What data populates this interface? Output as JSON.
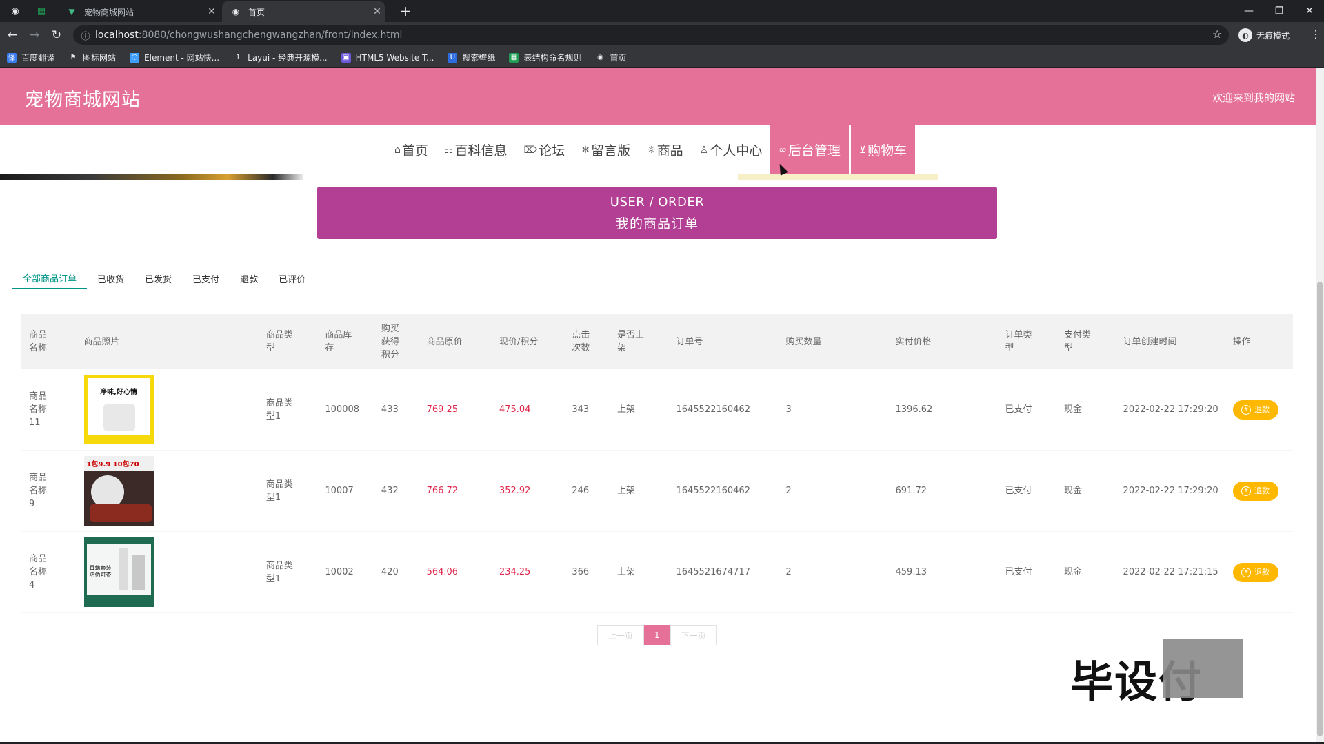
{
  "browser": {
    "tabs": [
      {
        "title": "宠物商城网站",
        "icon": "vue-favicon",
        "active": false
      },
      {
        "title": "首页",
        "icon": "globe-favicon",
        "active": true
      }
    ],
    "address": {
      "host": "localhost",
      "rest": ":8080/chongwushangchengwangzhan/front/index.html"
    },
    "incognito_label": "无痕模式",
    "bookmarks": [
      {
        "label": "百度翻译",
        "icon": "translate-icon",
        "color": "#3a7cf2"
      },
      {
        "label": "图标网站",
        "icon": "flag-icon",
        "color": "#555555"
      },
      {
        "label": "Element - 网站快...",
        "icon": "element-icon",
        "color": "#409eff"
      },
      {
        "label": "Layui - 经典开源模...",
        "icon": "layui-icon",
        "color": "#444444"
      },
      {
        "label": "HTML5 Website T...",
        "icon": "html5-icon",
        "color": "#6b57d8"
      },
      {
        "label": "搜索壁纸",
        "icon": "u-icon",
        "color": "#2d6cdf"
      },
      {
        "label": "表结构命名规则",
        "icon": "sheet-icon",
        "color": "#1f9d55"
      },
      {
        "label": "首页",
        "icon": "globe-icon",
        "color": "#777777"
      }
    ]
  },
  "site": {
    "title": "宠物商城网站",
    "welcome": "欢迎来到我的网站",
    "accent": "#e57198"
  },
  "nav": [
    {
      "label": "首页",
      "icon": "home-icon",
      "glyph": "⌂",
      "active": false
    },
    {
      "label": "百科信息",
      "icon": "apps-icon",
      "glyph": "⚏",
      "active": false
    },
    {
      "label": "论坛",
      "icon": "tag-icon",
      "glyph": "⌦",
      "active": false
    },
    {
      "label": "留言版",
      "icon": "snowflake-icon",
      "glyph": "❄",
      "active": false
    },
    {
      "label": "商品",
      "icon": "gear-icon",
      "glyph": "☼",
      "active": false
    },
    {
      "label": "个人中心",
      "icon": "user-icon",
      "glyph": "♙",
      "active": false
    },
    {
      "label": "后台管理",
      "icon": "link-icon",
      "glyph": "∞",
      "active": true
    },
    {
      "label": "购物车",
      "icon": "cart-icon",
      "glyph": "⊻",
      "active": true
    }
  ],
  "page_title": {
    "en": "USER / ORDER",
    "cn": "我的商品订单"
  },
  "order_tabs": [
    "全部商品订单",
    "已收货",
    "已发货",
    "已支付",
    "退款",
    "已评价"
  ],
  "table": {
    "headers": [
      "商品\n名称",
      "商品照片",
      "商品类\n型",
      "商品库\n存",
      "购买\n获得\n积分",
      "商品原价",
      "现价/积分",
      "点击\n次数",
      "是否上\n架",
      "订单号",
      "购买数量",
      "实付价格",
      "订单类\n型",
      "支付类\n型",
      "订单创建时间",
      "操作"
    ],
    "rows": [
      {
        "name": "商品\n名称\n11",
        "image": "paper-roll-product",
        "img_text": "净味,好心情",
        "type": "商品类\n型1",
        "stock": "100008",
        "points": "433",
        "orig_price": "769.25",
        "price": "475.04",
        "clicks": "343",
        "listed": "上架",
        "order_no": "1645522160462",
        "qty": "3",
        "paid": "1396.62",
        "order_type": "已支付",
        "pay_type": "现金",
        "created": "2022-02-22 17:29:20",
        "action": "退款"
      },
      {
        "name": "商品\n名称\n9",
        "image": "dog-treat-product",
        "img_text": "1包9.9 10包70",
        "type": "商品类\n型1",
        "stock": "10007",
        "points": "432",
        "orig_price": "766.72",
        "price": "352.92",
        "clicks": "246",
        "listed": "上架",
        "order_no": "1645522160462",
        "qty": "2",
        "paid": "691.72",
        "order_type": "已支付",
        "pay_type": "现金",
        "created": "2022-02-22 17:29:20",
        "action": "退款"
      },
      {
        "name": "商品\n名称\n4",
        "image": "ear-cleaner-product",
        "img_text": "耳螨套装\n防伪可查",
        "type": "商品类\n型1",
        "stock": "10002",
        "points": "420",
        "orig_price": "564.06",
        "price": "234.25",
        "clicks": "366",
        "listed": "上架",
        "order_no": "1645521674717",
        "qty": "2",
        "paid": "459.13",
        "order_type": "已支付",
        "pay_type": "现金",
        "created": "2022-02-22 17:21:15",
        "action": "退款"
      }
    ]
  },
  "pager": {
    "prev": "上一页",
    "current": "1",
    "next": "下一页"
  },
  "watermark": "毕设付"
}
